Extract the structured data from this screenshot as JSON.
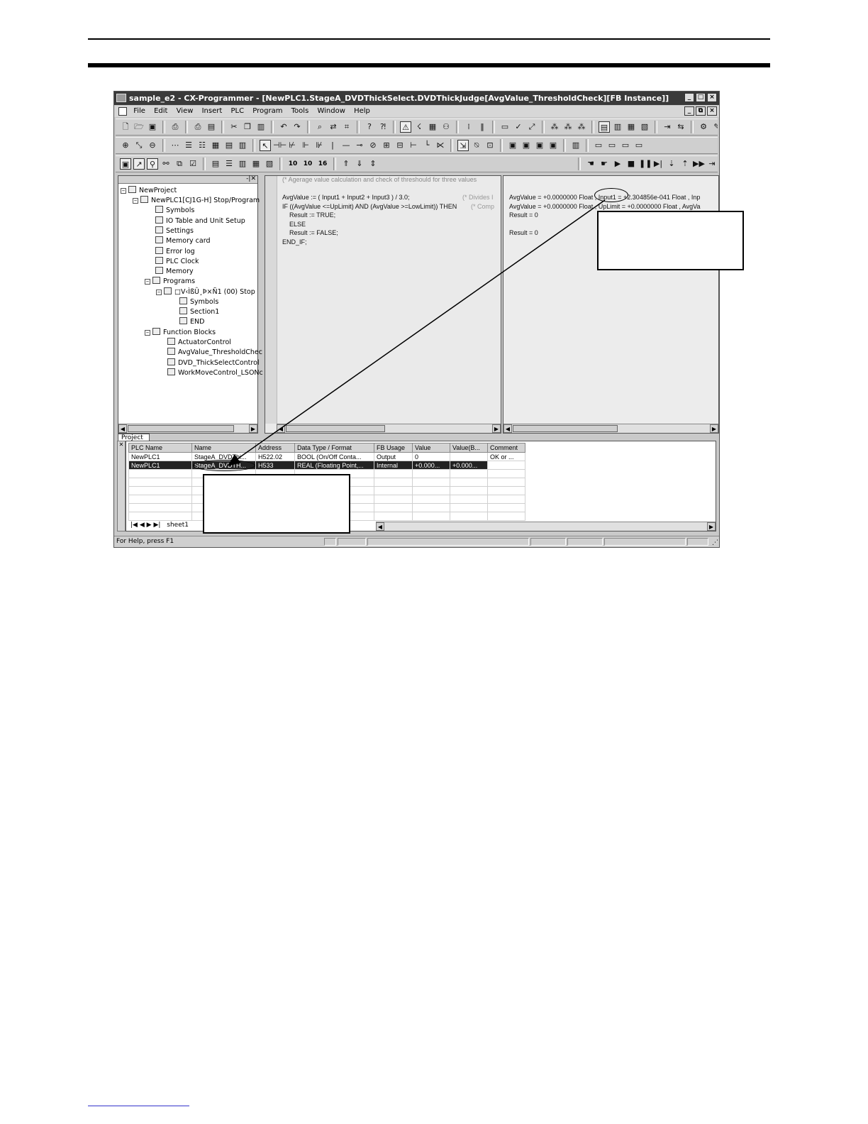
{
  "window": {
    "title": "sample_e2 - CX-Programmer - [NewPLC1.StageA_DVDThickSelect.DVDThickJudge[AvgValue_ThresholdCheck][FB Instance]]",
    "caption_buttons": [
      "_",
      "□",
      "×"
    ],
    "doc_buttons": [
      "_",
      "⧉",
      "×"
    ]
  },
  "menu": {
    "items": [
      "File",
      "Edit",
      "View",
      "Insert",
      "PLC",
      "Program",
      "Tools",
      "Window",
      "Help"
    ]
  },
  "toolbar3_numbers": [
    "10",
    "10",
    "16"
  ],
  "tree": {
    "items": [
      {
        "label": "NewProject"
      },
      {
        "label": "NewPLC1[CJ1G-H] Stop/Program"
      },
      {
        "label": "Symbols"
      },
      {
        "label": "IO Table and Unit Setup"
      },
      {
        "label": "Settings"
      },
      {
        "label": "Memory card"
      },
      {
        "label": "Error log"
      },
      {
        "label": "PLC Clock"
      },
      {
        "label": "Memory"
      },
      {
        "label": "Programs"
      },
      {
        "label": "□V‹ÌßÛ¸Þ×Ñ1 (00) Stop"
      },
      {
        "label": "Symbols"
      },
      {
        "label": "Section1"
      },
      {
        "label": "END"
      },
      {
        "label": "Function Blocks"
      },
      {
        "label": "ActuatorControl"
      },
      {
        "label": "AvgValue_ThresholdChec"
      },
      {
        "label": "DVD_ThickSelectControl"
      },
      {
        "label": "WorkMoveControl_LSONc"
      }
    ],
    "tab": "Project"
  },
  "code": {
    "comment": "(* Agerage value calculation and check of threshould for three values",
    "lines": [
      "AvgValue := ( Input1 + Input2 + Input3 ) / 3.0;",
      "IF ((AvgValue <=UpLimit) AND (AvgValue >=LowLimit)) THEN",
      "    Result := TRUE;",
      "    ELSE",
      "    Result := FALSE;",
      "END_IF;"
    ],
    "trail1": "(* Divides I",
    "trail2": "(* Comp"
  },
  "watch": {
    "lines": [
      "AvgValue = +0.0000000 Float , Input1 = +2.304856e-041 Float , Inp",
      "AvgValue = +0.0000000 Float , UpLimit = +0.0000000 Float , AvgVa",
      "Result = 0",
      "",
      "Result = 0"
    ]
  },
  "grid": {
    "columns": [
      "PLC Name",
      "Name",
      "Address",
      "Data Type / Format",
      "FB Usage",
      "Value",
      "Value(B...",
      "Comment"
    ],
    "rows": [
      [
        "NewPLC1",
        "StageA_DVDThi...",
        "H522.02",
        "BOOL (On/Off Conta...",
        "Output",
        "0",
        "",
        "OK or ..."
      ],
      [
        "NewPLC1",
        "StageA_DVDTH...",
        "H533",
        "REAL (Floating Point,...",
        "Internal",
        "+0.000...",
        "+0.000...",
        ""
      ]
    ],
    "sheet_tab": "sheet1"
  },
  "statusbar": {
    "text": "For Help, press F1"
  }
}
